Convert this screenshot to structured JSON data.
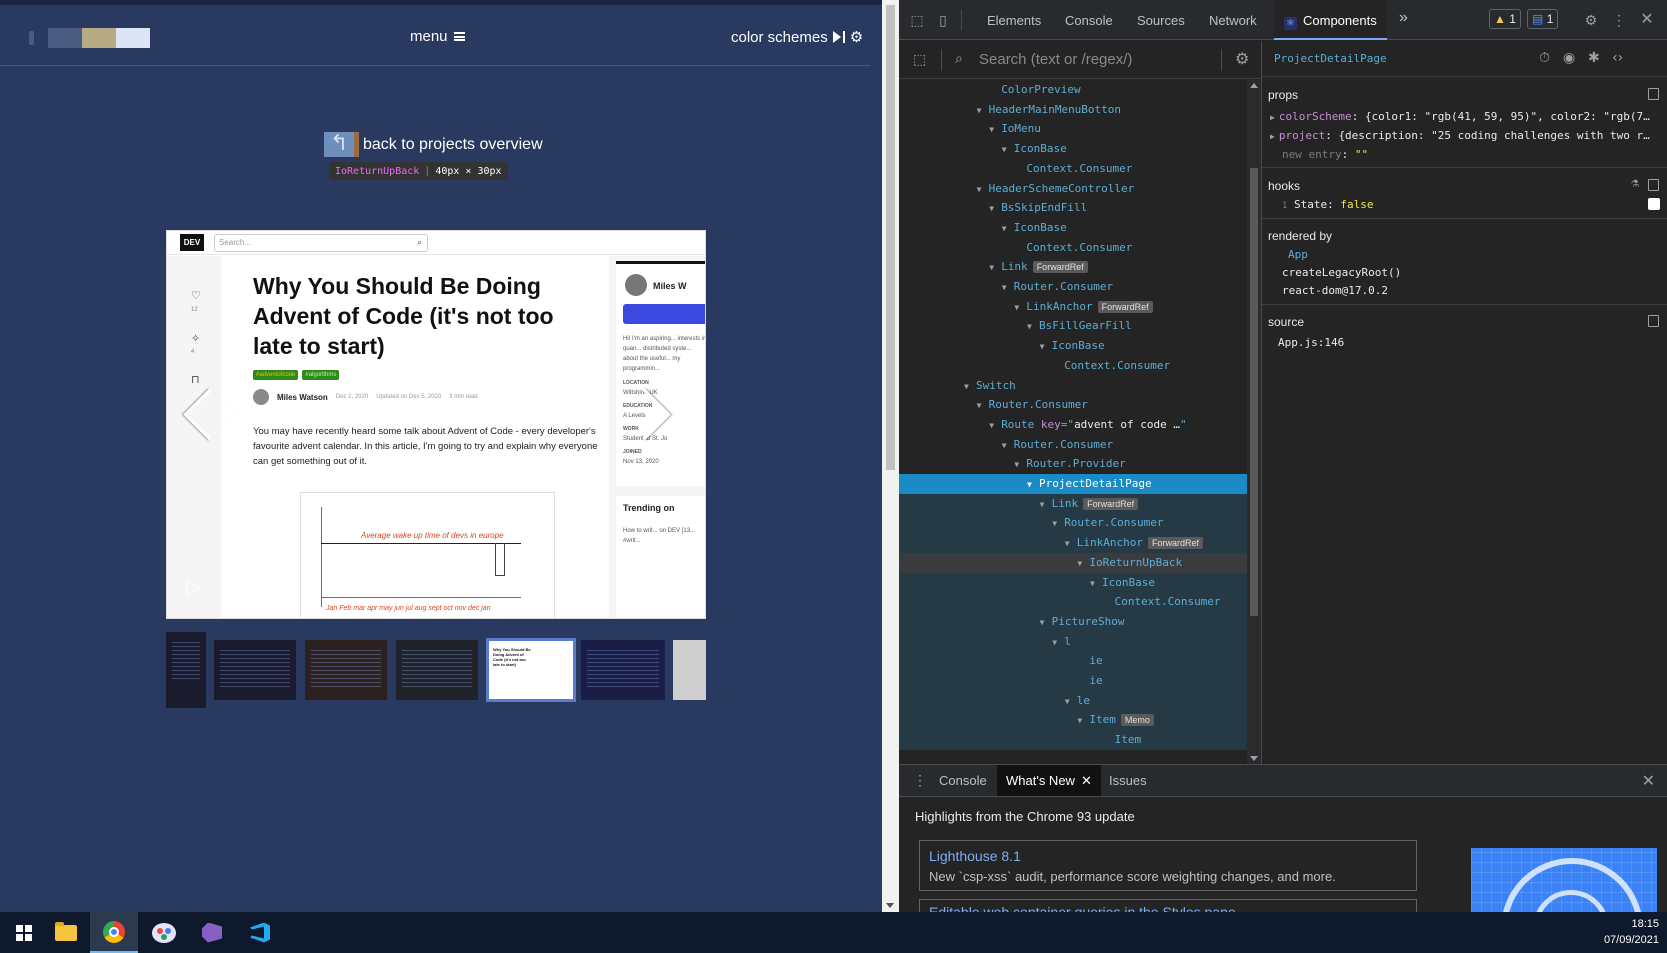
{
  "page": {
    "menu_label": "menu",
    "color_schemes_label": "color schemes",
    "back_label": "back to projects overview",
    "inspect_tooltip": {
      "component": "IoReturnUpBack",
      "size": "40px × 30px"
    },
    "swatch_colors": [
      "#4a5a80",
      "#b6ab84",
      "#dce4f5"
    ]
  },
  "article": {
    "logo": "DEV",
    "search_placeholder": "Search...",
    "title": "Why You Should Be Doing Advent of Code (it's not too late to start)",
    "tags": [
      "#adventofcode",
      "#algorithms"
    ],
    "author": "Miles Watson",
    "date": "Dec 2, 2020",
    "updated": "Updated on Dec 5, 2020",
    "read_time": "3 min read",
    "body": "You may have recently heard some talk about Advent of Code - every developer's favourite advent calendar. In this article, I'm going to try and explain why everyone can get something out of it.",
    "likes": "12",
    "unicorns": "4",
    "chart_caption": "Average wake up time of devs in europe",
    "chart_caption2": "Jan Feb mar apr may jun jul aug sept oct nov dec jan",
    "profile_name": "Miles W",
    "profile_bio": "Hi! I'm an aspiring... interests in quan... distributed syste... about the useful... my programmin...",
    "location_label": "LOCATION",
    "location": "Wiltshire, UK",
    "education_label": "EDUCATION",
    "education": "A Levels",
    "work_label": "WORK",
    "work": "Student at St. Jo",
    "joined_label": "JOINED",
    "joined": "Nov 13, 2020",
    "trending": "Trending on",
    "trending_item": "How to writ... on DEV [13... #writ..."
  },
  "devtools": {
    "tabs": [
      "Elements",
      "Console",
      "Sources",
      "Network",
      "Components"
    ],
    "active_tab": "Components",
    "more": "»",
    "warnings": "1",
    "messages": "1",
    "search_placeholder": "Search (text or /regex/)",
    "tree": [
      {
        "label": "ColorPreview",
        "depth": 7,
        "arrow": ""
      },
      {
        "label": "HeaderMainMenuBotton",
        "depth": 6,
        "arrow": "▼"
      },
      {
        "label": "IoMenu",
        "depth": 7,
        "arrow": "▼"
      },
      {
        "label": "IconBase",
        "depth": 8,
        "arrow": "▼"
      },
      {
        "label": "Context.Consumer",
        "depth": 9,
        "arrow": ""
      },
      {
        "label": "HeaderSchemeController",
        "depth": 6,
        "arrow": "▼"
      },
      {
        "label": "BsSkipEndFill",
        "depth": 7,
        "arrow": "▼"
      },
      {
        "label": "IconBase",
        "depth": 8,
        "arrow": "▼"
      },
      {
        "label": "Context.Consumer",
        "depth": 9,
        "arrow": ""
      },
      {
        "label": "Link",
        "depth": 7,
        "arrow": "▼",
        "badge": "ForwardRef"
      },
      {
        "label": "Router.Consumer",
        "depth": 8,
        "arrow": "▼"
      },
      {
        "label": "LinkAnchor",
        "depth": 9,
        "arrow": "▼",
        "badge": "ForwardRef"
      },
      {
        "label": "BsFillGearFill",
        "depth": 10,
        "arrow": "▼"
      },
      {
        "label": "IconBase",
        "depth": 11,
        "arrow": "▼"
      },
      {
        "label": "Context.Consumer",
        "depth": 12,
        "arrow": ""
      },
      {
        "label": "Switch",
        "depth": 5,
        "arrow": "▼"
      },
      {
        "label": "Router.Consumer",
        "depth": 6,
        "arrow": "▼"
      },
      {
        "label": "Route",
        "depth": 7,
        "arrow": "▼",
        "key": "advent of code …"
      },
      {
        "label": "Router.Consumer",
        "depth": 8,
        "arrow": "▼"
      },
      {
        "label": "Router.Provider",
        "depth": 9,
        "arrow": "▼"
      },
      {
        "label": "ProjectDetailPage",
        "depth": 10,
        "arrow": "▼",
        "state": "selected"
      },
      {
        "label": "Link",
        "depth": 11,
        "arrow": "▼",
        "badge": "ForwardRef",
        "state": "owned"
      },
      {
        "label": "Router.Consumer",
        "depth": 12,
        "arrow": "▼",
        "state": "owned"
      },
      {
        "label": "LinkAnchor",
        "depth": 13,
        "arrow": "▼",
        "badge": "ForwardRef",
        "state": "owned"
      },
      {
        "label": "IoReturnUpBack",
        "depth": 14,
        "arrow": "▼",
        "state": "hover"
      },
      {
        "label": "IconBase",
        "depth": 15,
        "arrow": "▼",
        "state": "owned"
      },
      {
        "label": "Context.Consumer",
        "depth": 16,
        "arrow": "",
        "state": "owned"
      },
      {
        "label": "PictureShow",
        "depth": 11,
        "arrow": "▼",
        "state": "owned"
      },
      {
        "label": "l",
        "depth": 12,
        "arrow": "▼",
        "state": "owned"
      },
      {
        "label": "ie",
        "depth": 14,
        "arrow": "",
        "state": "owned"
      },
      {
        "label": "ie",
        "depth": 14,
        "arrow": "",
        "state": "owned"
      },
      {
        "label": "le",
        "depth": 13,
        "arrow": "▼",
        "state": "owned"
      },
      {
        "label": "Item",
        "depth": 14,
        "arrow": "▼",
        "badge": "Memo",
        "state": "owned"
      },
      {
        "label": "Item",
        "depth": 16,
        "arrow": "",
        "state": "owned"
      }
    ],
    "selected_component": "ProjectDetailPage",
    "props_title": "props",
    "props": [
      {
        "key": "colorScheme",
        "value": "{color1: \"rgb(41, 59, 95)\", color2: \"rgb(7…"
      },
      {
        "key": "project",
        "value": "{description: \"25 coding challenges with two r…"
      }
    ],
    "new_entry_label": "new entry",
    "new_entry_value": "\"\"",
    "hooks_title": "hooks",
    "hook": {
      "index": "1",
      "name": "State:",
      "value": "false"
    },
    "rendered_by_title": "rendered by",
    "rendered_by": [
      "App",
      "createLegacyRoot()",
      "react-dom@17.0.2"
    ],
    "source_title": "source",
    "source": "App.js:146"
  },
  "drawer": {
    "tabs": [
      "Console",
      "What's New",
      "Issues"
    ],
    "active_tab": "What's New",
    "highlights": "Highlights from the Chrome 93 update",
    "cards": [
      {
        "title": "Lighthouse 8.1",
        "desc": "New `csp-xss` audit, performance score weighting changes, and more."
      },
      {
        "title": "Editable web container queries in the Styles pane",
        "desc": ""
      }
    ]
  },
  "taskbar": {
    "time": "18:15",
    "date": "07/09/2021"
  }
}
